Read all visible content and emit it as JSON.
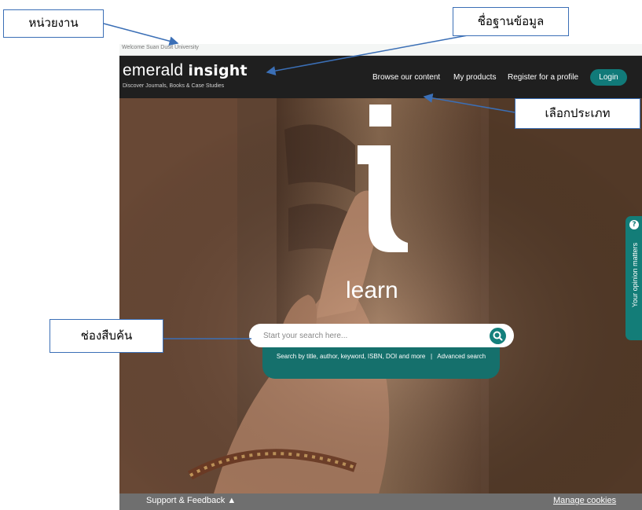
{
  "site": {
    "welcome": "Welcome Suan Dusit University",
    "logo": {
      "word1": "emerald",
      "word2": "insight",
      "tagline": "Discover Journals, Books & Case Studies"
    },
    "nav": [
      {
        "label": "Browse our content"
      },
      {
        "label": "My products"
      },
      {
        "label": "Register for a profile"
      }
    ],
    "login_label": "Login",
    "hero": {
      "word": "learn",
      "search_placeholder": "Start your search here...",
      "hint_text": "Search by title, author, keyword, ISBN, DOI and more",
      "hint_sep": "|",
      "hint_link": "Advanced search"
    },
    "opinion": {
      "label": "Your opinion matters",
      "badge": "?"
    },
    "footer": {
      "support": "Support & Feedback ▲",
      "cookies": "Manage cookies"
    }
  },
  "annotations": {
    "agency": "หน่วยงาน",
    "database_name": "ชื่อฐานข้อมูล",
    "choose_type": "เลือกประเภท",
    "search_field": "ช่องสืบค้น"
  },
  "colors": {
    "teal": "#117a79",
    "header": "#1f1f1f",
    "footer": "#6f6f6f",
    "annotation_blue": "#3b6fb6"
  },
  "icons": [
    "search-icon",
    "question-icon",
    "caret-up-icon"
  ]
}
